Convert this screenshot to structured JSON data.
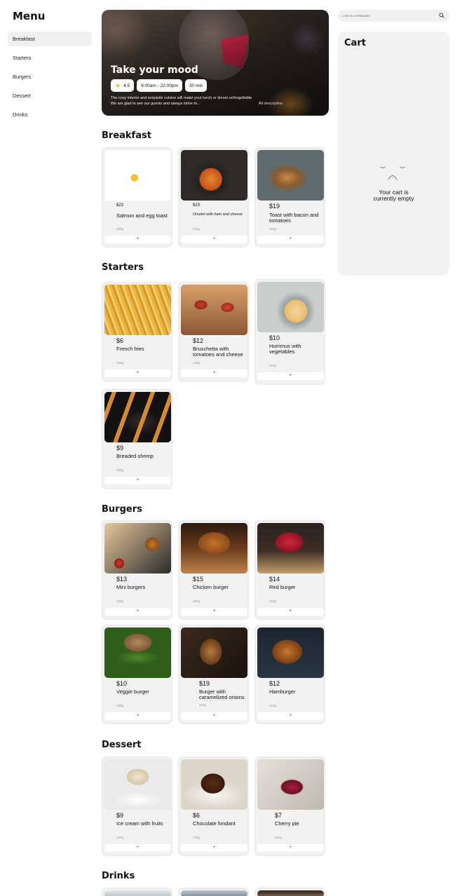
{
  "menu": {
    "title": "Menu",
    "items": [
      "Breakfast",
      "Starters",
      "Burgers",
      "Dessert",
      "Drinks"
    ]
  },
  "hero": {
    "title": "Take your mood",
    "rating": "4.5",
    "hours": "9:00am - 22:00pm",
    "time": "30 min",
    "description": "The cozy interior and exquisite cuisine will make your lunch or dinner unforgettable. We are glad to see our guests and always strive to...",
    "all_description": "All description"
  },
  "search": {
    "placeholder": "Look in a restaurant"
  },
  "cart": {
    "title": "Cart",
    "empty_text": "Your cart is currently empty"
  },
  "add_label": "+",
  "sections": {
    "breakfast": {
      "title": "Breakfast",
      "items": [
        {
          "price": "$23",
          "name": "Salmon and egg toast",
          "weight": "330g"
        },
        {
          "price": "$23",
          "name": "Omelet with ham and cheese",
          "weight": "330g"
        },
        {
          "price": "$19",
          "name": "Toast with bacon and tomatoes",
          "weight": "320g"
        }
      ]
    },
    "starters": {
      "title": "Starters",
      "items": [
        {
          "price": "$6",
          "name": "French fries",
          "weight": "330g"
        },
        {
          "price": "$12",
          "name": "Bruschetta with tomatoes and cheese",
          "weight": "330g"
        },
        {
          "price": "$10",
          "name": "Hummus with vegetables",
          "weight": "320g"
        },
        {
          "price": "$9",
          "name": "Breaded shrimp",
          "weight": "330g"
        }
      ]
    },
    "burgers": {
      "title": "Burgers",
      "items": [
        {
          "price": "$13",
          "name": "Mini burgers",
          "weight": "330g"
        },
        {
          "price": "$15",
          "name": "Chicken burger",
          "weight": "330g"
        },
        {
          "price": "$14",
          "name": "Red burger",
          "weight": "320g"
        },
        {
          "price": "$10",
          "name": "Veggie burger",
          "weight": "330g"
        },
        {
          "price": "$19",
          "name": "Burger with caramelized onions and bacon",
          "weight": "330g"
        },
        {
          "price": "$12",
          "name": "Hamburger",
          "weight": "320g"
        }
      ]
    },
    "dessert": {
      "title": "Dessert",
      "items": [
        {
          "price": "$9",
          "name": "Ice cream with fruits",
          "weight": "330g"
        },
        {
          "price": "$6",
          "name": "Chocolate fondant",
          "weight": "330g"
        },
        {
          "price": "$7",
          "name": "Cherry pie",
          "weight": "350g"
        }
      ]
    },
    "drinks": {
      "title": "Drinks"
    }
  }
}
